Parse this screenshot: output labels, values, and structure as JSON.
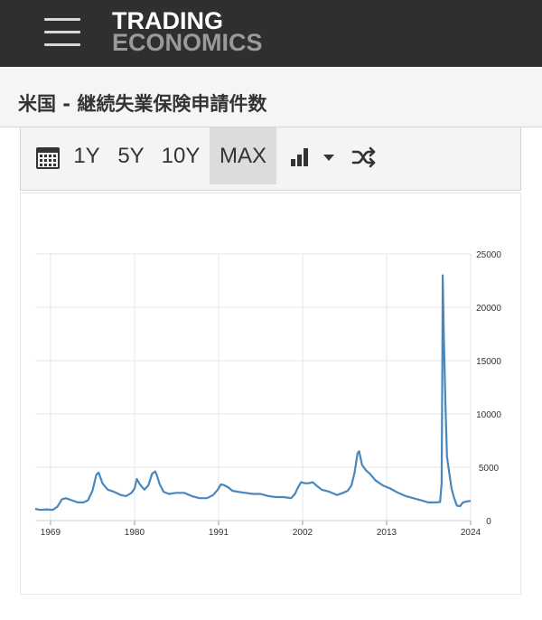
{
  "header": {
    "logo_line1": "TRADING",
    "logo_line2": "ECONOMICS"
  },
  "page": {
    "title": "米国 - 継続失業保険申請件数"
  },
  "toolbar": {
    "ranges": [
      "1Y",
      "5Y",
      "10Y",
      "MAX"
    ],
    "active_range": "MAX"
  },
  "colors": {
    "line": "#4a87bd",
    "grid": "#e6e6e6",
    "header_bg": "#2f2f2f",
    "active_tab_bg": "#dcdcdc"
  },
  "chart_data": {
    "type": "line",
    "title": "",
    "xlabel": "",
    "ylabel": "",
    "ylim": [
      0,
      25000
    ],
    "xlim": [
      1967,
      2024
    ],
    "x_tick_labels": [
      "1969",
      "1980",
      "1991",
      "2002",
      "2013",
      "2024"
    ],
    "y_tick_labels": [
      "0",
      "5000",
      "10000",
      "15000",
      "20000",
      "25000"
    ],
    "grid": true,
    "series": [
      {
        "x": [
          1967.0,
          1967.6,
          1968.5,
          1969.3,
          1969.9,
          1970.5,
          1971.0,
          1971.8,
          1972.6,
          1973.3,
          1973.9,
          1974.5,
          1975.0,
          1975.3,
          1975.8,
          1976.5,
          1977.3,
          1978.2,
          1978.9,
          1979.6,
          1980.0,
          1980.3,
          1980.7,
          1981.3,
          1981.8,
          1982.3,
          1982.7,
          1982.9,
          1983.3,
          1983.8,
          1984.5,
          1985.5,
          1986.5,
          1987.5,
          1988.5,
          1989.5,
          1990.3,
          1990.9,
          1991.3,
          1991.8,
          1992.3,
          1992.8,
          1993.5,
          1994.5,
          1995.5,
          1996.5,
          1997.5,
          1998.5,
          1999.5,
          2000.5,
          2001.0,
          2001.4,
          2001.8,
          2002.3,
          2002.8,
          2003.3,
          2003.8,
          2004.5,
          2005.5,
          2006.5,
          2007.3,
          2007.9,
          2008.4,
          2008.8,
          2009.2,
          2009.4,
          2009.8,
          2010.3,
          2010.8,
          2011.5,
          2012.5,
          2013.5,
          2014.5,
          2015.5,
          2016.5,
          2017.5,
          2018.5,
          2019.5,
          2020.0,
          2020.2,
          2020.3,
          2020.35,
          2020.5,
          2020.7,
          2020.9,
          2021.2,
          2021.5,
          2021.8,
          2022.2,
          2022.6,
          2023.0,
          2023.5,
          2024.0
        ],
        "values": [
          1100,
          1000,
          1050,
          1000,
          1300,
          2000,
          2100,
          1900,
          1700,
          1700,
          1900,
          2800,
          4300,
          4500,
          3500,
          2900,
          2700,
          2400,
          2300,
          2600,
          3000,
          3900,
          3400,
          2900,
          3300,
          4400,
          4600,
          4300,
          3400,
          2700,
          2500,
          2600,
          2600,
          2300,
          2100,
          2100,
          2400,
          2900,
          3400,
          3300,
          3100,
          2800,
          2700,
          2600,
          2500,
          2500,
          2300,
          2200,
          2200,
          2100,
          2500,
          3100,
          3600,
          3500,
          3500,
          3600,
          3300,
          2900,
          2700,
          2400,
          2600,
          2800,
          3300,
          4500,
          6300,
          6500,
          5200,
          4700,
          4400,
          3800,
          3300,
          3000,
          2600,
          2300,
          2100,
          1900,
          1700,
          1700,
          1750,
          3500,
          15000,
          23000,
          17000,
          11000,
          6000,
          4500,
          3000,
          2200,
          1400,
          1350,
          1700,
          1800,
          1850
        ]
      }
    ]
  }
}
